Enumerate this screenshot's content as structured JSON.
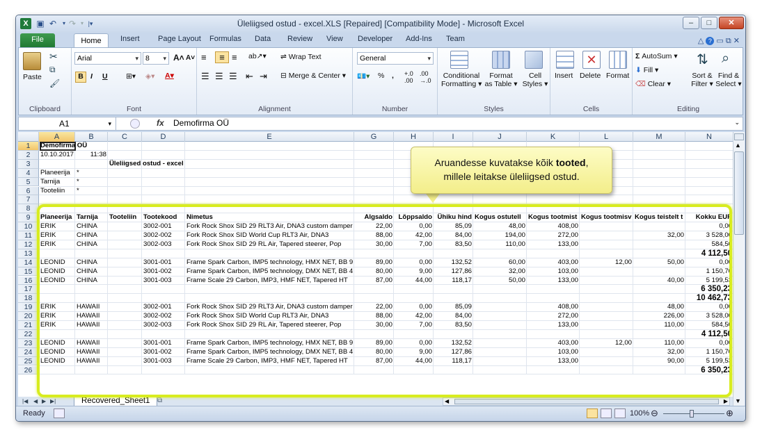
{
  "window": {
    "title": "Üleliigsed ostud - excel.XLS [Repaired]  [Compatibility Mode]  -  Microsoft Excel",
    "controls": [
      "–",
      "□",
      "✕"
    ]
  },
  "tabs": {
    "file": "File",
    "items": [
      "Home",
      "Insert",
      "Page Layout",
      "Formulas",
      "Data",
      "Review",
      "View",
      "Developer",
      "Add-Ins",
      "Team"
    ]
  },
  "ribbon": {
    "clipboard": {
      "label": "Clipboard",
      "paste": "Paste"
    },
    "font": {
      "label": "Font",
      "name": "Arial",
      "size": "8"
    },
    "alignment": {
      "label": "Alignment",
      "wrap": "Wrap Text",
      "merge": "Merge & Center"
    },
    "number": {
      "label": "Number",
      "format": "General"
    },
    "styles": {
      "label": "Styles",
      "conditional": [
        "Conditional",
        "Formatting"
      ],
      "format_table": [
        "Format",
        "as Table"
      ],
      "cell_styles": [
        "Cell",
        "Styles"
      ]
    },
    "cells": {
      "label": "Cells",
      "insert": "Insert",
      "delete": "Delete",
      "format": "Format"
    },
    "editing": {
      "label": "Editing",
      "autosum": "AutoSum",
      "fill": "Fill",
      "clear": "Clear",
      "sort": [
        "Sort &",
        "Filter"
      ],
      "find": [
        "Find &",
        "Select"
      ]
    }
  },
  "formula_bar": {
    "cell": "A1",
    "fx": "fx",
    "content": "Demofirma OÜ"
  },
  "columns": [
    "A",
    "B",
    "C",
    "D",
    "E",
    "G",
    "H",
    "I",
    "J",
    "K",
    "L",
    "M",
    "N"
  ],
  "rows": [
    "1",
    "2",
    "3",
    "4",
    "5",
    "6",
    "7",
    "8",
    "9",
    "10",
    "11",
    "12",
    "13",
    "14",
    "15",
    "16",
    "17",
    "18",
    "19",
    "20",
    "21",
    "22",
    "23",
    "24",
    "25",
    "26"
  ],
  "sheet": {
    "r1": {
      "a": "Demofirma OÜ"
    },
    "r2": {
      "a": "10.10.2017",
      "b": "11:38"
    },
    "r3": {
      "c": "Üleliigsed ostud - excel"
    },
    "r4": {
      "a": "Planeerija",
      "b": "*"
    },
    "r5": {
      "a": "Tarnija",
      "b": "*"
    },
    "r6": {
      "a": "Tooteliin",
      "b": "*"
    },
    "headers": [
      "Planeerija",
      "Tarnija",
      "Tooteliin",
      "Tootekood",
      "Nimetus",
      "Algsaldo",
      "Lõppsaldo",
      "Ühiku hind",
      "Kogus ostutell",
      "Kogus tootmist",
      "Kogus tootmisv",
      "Kogus teistelt t",
      "Kokku EUR"
    ],
    "data": [
      {
        "row": "10",
        "cells": [
          "ERIK",
          "CHINA",
          "",
          "3002-001",
          "Fork Rock Shox SID 29 RLT3 Air, DNA3 custom damper",
          "22,00",
          "0,00",
          "85,09",
          "48,00",
          "408,00",
          "",
          "",
          "0,00"
        ]
      },
      {
        "row": "11",
        "cells": [
          "ERIK",
          "CHINA",
          "",
          "3002-002",
          "Fork Rock Shox SID World Cup RLT3 Air, DNA3",
          "88,00",
          "42,00",
          "84,00",
          "194,00",
          "272,00",
          "",
          "32,00",
          "3 528,00"
        ]
      },
      {
        "row": "12",
        "cells": [
          "ERIK",
          "CHINA",
          "",
          "3002-003",
          "Fork Rock Shox SID 29 RL Air, Tapered steerer, Pop",
          "30,00",
          "7,00",
          "83,50",
          "110,00",
          "133,00",
          "",
          "",
          "584,50"
        ]
      },
      {
        "row": "13",
        "cells": [
          "",
          "",
          "",
          "",
          "",
          "",
          "",
          "",
          "",
          "",
          "",
          "",
          "4 112,50"
        ],
        "total": true
      },
      {
        "row": "14",
        "cells": [
          "LEONID",
          "CHINA",
          "",
          "3001-001",
          "Frame Spark Carbon, IMP5 technology, HMX NET, BB 9",
          "89,00",
          "0,00",
          "132,52",
          "60,00",
          "403,00",
          "12,00",
          "50,00",
          "0,00"
        ]
      },
      {
        "row": "15",
        "cells": [
          "LEONID",
          "CHINA",
          "",
          "3001-002",
          "Frame Spark Carbon, IMP5 technology, DMX NET, BB 4",
          "80,00",
          "9,00",
          "127,86",
          "32,00",
          "103,00",
          "",
          "",
          "1 150,70"
        ]
      },
      {
        "row": "16",
        "cells": [
          "LEONID",
          "CHINA",
          "",
          "3001-003",
          "Frame Scale 29 Carbon, IMP3, HMF NET, Tapered HT",
          "87,00",
          "44,00",
          "118,17",
          "50,00",
          "133,00",
          "",
          "40,00",
          "5 199,53"
        ]
      },
      {
        "row": "17",
        "cells": [
          "",
          "",
          "",
          "",
          "",
          "",
          "",
          "",
          "",
          "",
          "",
          "",
          "6 350,23"
        ],
        "total": true
      },
      {
        "row": "18",
        "cells": [
          "",
          "",
          "",
          "",
          "",
          "",
          "",
          "",
          "",
          "",
          "",
          "",
          "10 462,73"
        ],
        "total": true
      },
      {
        "row": "19",
        "cells": [
          "ERIK",
          "HAWAII",
          "",
          "3002-001",
          "Fork Rock Shox SID 29 RLT3 Air, DNA3 custom damper",
          "22,00",
          "0,00",
          "85,09",
          "",
          "408,00",
          "",
          "48,00",
          "0,00"
        ]
      },
      {
        "row": "20",
        "cells": [
          "ERIK",
          "HAWAII",
          "",
          "3002-002",
          "Fork Rock Shox SID World Cup RLT3 Air, DNA3",
          "88,00",
          "42,00",
          "84,00",
          "",
          "272,00",
          "",
          "226,00",
          "3 528,00"
        ]
      },
      {
        "row": "21",
        "cells": [
          "ERIK",
          "HAWAII",
          "",
          "3002-003",
          "Fork Rock Shox SID 29 RL Air, Tapered steerer, Pop",
          "30,00",
          "7,00",
          "83,50",
          "",
          "133,00",
          "",
          "110,00",
          "584,50"
        ]
      },
      {
        "row": "22",
        "cells": [
          "",
          "",
          "",
          "",
          "",
          "",
          "",
          "",
          "",
          "",
          "",
          "",
          "4 112,50"
        ],
        "total": true
      },
      {
        "row": "23",
        "cells": [
          "LEONID",
          "HAWAII",
          "",
          "3001-001",
          "Frame Spark Carbon, IMP5 technology, HMX NET, BB 9",
          "89,00",
          "0,00",
          "132,52",
          "",
          "403,00",
          "12,00",
          "110,00",
          "0,00"
        ]
      },
      {
        "row": "24",
        "cells": [
          "LEONID",
          "HAWAII",
          "",
          "3001-002",
          "Frame Spark Carbon, IMP5 technology, DMX NET, BB 4",
          "80,00",
          "9,00",
          "127,86",
          "",
          "103,00",
          "",
          "32,00",
          "1 150,70"
        ]
      },
      {
        "row": "25",
        "cells": [
          "LEONID",
          "HAWAII",
          "",
          "3001-003",
          "Frame Scale 29 Carbon, IMP3, HMF NET, Tapered HT",
          "87,00",
          "44,00",
          "118,17",
          "",
          "133,00",
          "",
          "90,00",
          "5 199,53"
        ]
      },
      {
        "row": "26",
        "cells": [
          "",
          "",
          "",
          "",
          "",
          "",
          "",
          "",
          "",
          "",
          "",
          "",
          "6 350,23"
        ],
        "total": true
      }
    ]
  },
  "sheet_tab": "Recovered_Sheet1",
  "status": {
    "ready": "Ready",
    "zoom": "100%"
  },
  "callout": {
    "before": "Aruandesse kuvatakse kõik ",
    "bold": "tooted",
    "after": ",",
    "line2": "millele leitakse üleliigsed ostud."
  },
  "colors": {
    "highlight": "#d8ec1f",
    "callout_bg": "#f7f29e",
    "excel_green": "#207a33"
  }
}
